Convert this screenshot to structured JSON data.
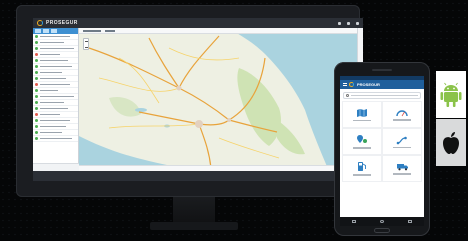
{
  "app": {
    "title": "PROSEGUR",
    "brand_colors": {
      "ring_orange": "#f2b01e",
      "ring_blue": "#37a3e0",
      "header": "#2b2f36"
    }
  },
  "desktop": {
    "sidebar_rows": 18,
    "map_region": "Central Mexico road map"
  },
  "phone": {
    "app_title": "PROSEGUR",
    "tiles": [
      {
        "icon": "map-icon"
      },
      {
        "icon": "speedometer-icon"
      },
      {
        "icon": "location-pin-icon"
      },
      {
        "icon": "route-icon"
      },
      {
        "icon": "fuel-pump-icon"
      },
      {
        "icon": "truck-icon"
      }
    ]
  },
  "platforms": [
    {
      "name": "android",
      "icon": "android-icon",
      "color": "#8bc34a"
    },
    {
      "name": "apple",
      "icon": "apple-icon",
      "color": "#111111"
    }
  ]
}
